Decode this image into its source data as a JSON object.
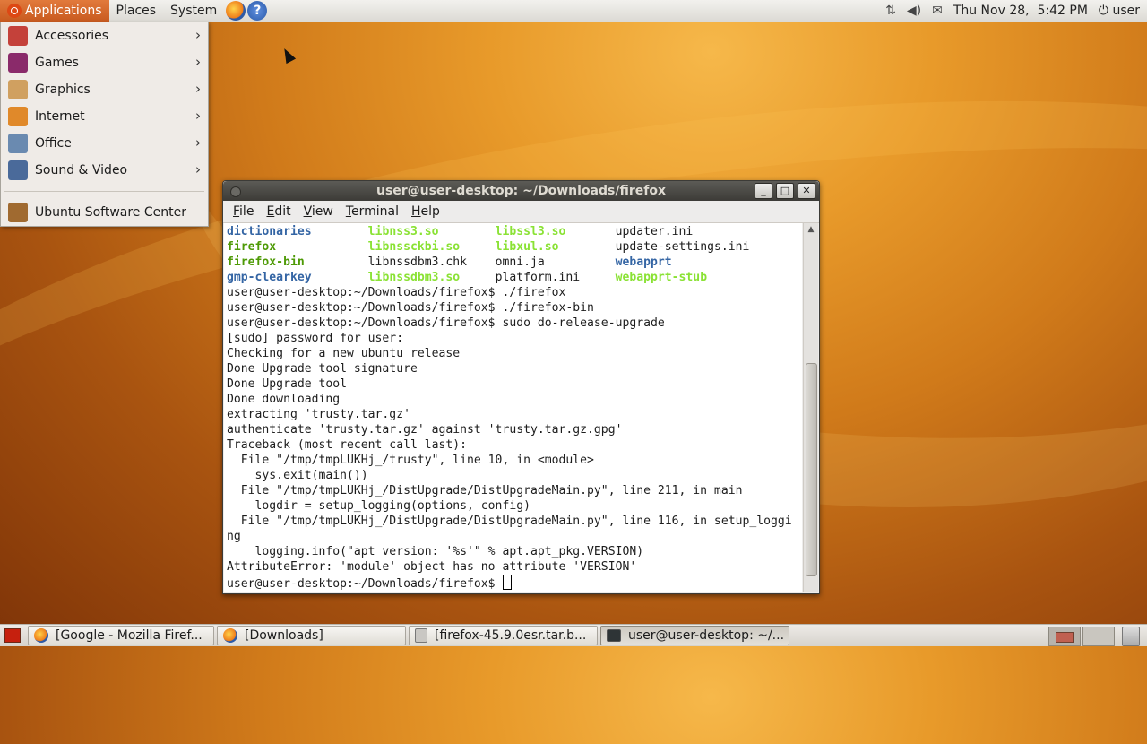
{
  "top_panel": {
    "menus": [
      "Applications",
      "Places",
      "System"
    ],
    "launchers": [
      "firefox-icon",
      "help-icon"
    ],
    "tray": {
      "icons": [
        "network-icon",
        "volume-icon",
        "mail-icon"
      ],
      "clock": "Thu Nov 28,  5:42 PM",
      "user": "user"
    }
  },
  "applications_menu": {
    "items": [
      {
        "label": "Accessories",
        "icon": "accessories-icon",
        "color": "#c4413a",
        "submenu": true
      },
      {
        "label": "Games",
        "icon": "games-icon",
        "color": "#8a2a6a",
        "submenu": true
      },
      {
        "label": "Graphics",
        "icon": "graphics-icon",
        "color": "#d0a060",
        "submenu": true
      },
      {
        "label": "Internet",
        "icon": "internet-icon",
        "color": "#e0892a",
        "submenu": true
      },
      {
        "label": "Office",
        "icon": "office-icon",
        "color": "#6a8ab0",
        "submenu": true
      },
      {
        "label": "Sound & Video",
        "icon": "sound-video-icon",
        "color": "#4a6a9a",
        "submenu": true
      }
    ],
    "footer_item": {
      "label": "Ubuntu Software Center",
      "icon": "software-center-icon",
      "color": "#a06a30"
    }
  },
  "terminal": {
    "title": "user@user-desktop: ~/Downloads/firefox",
    "menu": [
      "File",
      "Edit",
      "View",
      "Terminal",
      "Help"
    ],
    "ls_rows": [
      [
        {
          "t": "dictionaries",
          "c": "blue"
        },
        {
          "t": "libnss3.so",
          "c": "green2"
        },
        {
          "t": "libssl3.so",
          "c": "green2"
        },
        {
          "t": "updater.ini",
          "c": "plain"
        }
      ],
      [
        {
          "t": "firefox",
          "c": "green"
        },
        {
          "t": "libnssckbi.so",
          "c": "green2"
        },
        {
          "t": "libxul.so",
          "c": "green2"
        },
        {
          "t": "update-settings.ini",
          "c": "plain"
        }
      ],
      [
        {
          "t": "firefox-bin",
          "c": "green"
        },
        {
          "t": "libnssdbm3.chk",
          "c": "plain"
        },
        {
          "t": "omni.ja",
          "c": "plain"
        },
        {
          "t": "webapprt",
          "c": "blue"
        }
      ],
      [
        {
          "t": "gmp-clearkey",
          "c": "blue"
        },
        {
          "t": "libnssdbm3.so",
          "c": "green2"
        },
        {
          "t": "platform.ini",
          "c": "plain"
        },
        {
          "t": "webapprt-stub",
          "c": "green2"
        }
      ]
    ],
    "lines": [
      "user@user-desktop:~/Downloads/firefox$ ./firefox",
      "user@user-desktop:~/Downloads/firefox$ ./firefox-bin",
      "user@user-desktop:~/Downloads/firefox$ sudo do-release-upgrade",
      "[sudo] password for user:",
      "Checking for a new ubuntu release",
      "Done Upgrade tool signature",
      "Done Upgrade tool",
      "Done downloading",
      "extracting 'trusty.tar.gz'",
      "authenticate 'trusty.tar.gz' against 'trusty.tar.gz.gpg'",
      "Traceback (most recent call last):",
      "  File \"/tmp/tmpLUKHj_/trusty\", line 10, in <module>",
      "    sys.exit(main())",
      "  File \"/tmp/tmpLUKHj_/DistUpgrade/DistUpgradeMain.py\", line 211, in main",
      "    logdir = setup_logging(options, config)",
      "  File \"/tmp/tmpLUKHj_/DistUpgrade/DistUpgradeMain.py\", line 116, in setup_loggi",
      "ng",
      "    logging.info(\"apt version: '%s'\" % apt.apt_pkg.VERSION)",
      "AttributeError: 'module' object has no attribute 'VERSION'"
    ],
    "prompt": "user@user-desktop:~/Downloads/firefox$ "
  },
  "taskbar": {
    "tasks": [
      {
        "label": "[Google - Mozilla Firef...",
        "icon": "firefox-icon",
        "active": false
      },
      {
        "label": "[Downloads]",
        "icon": "folder-icon",
        "active": false
      },
      {
        "label": "[firefox-45.9.0esr.tar.b...",
        "icon": "archive-icon",
        "active": false
      },
      {
        "label": "user@user-desktop: ~/...",
        "icon": "terminal-icon",
        "active": true
      }
    ]
  }
}
